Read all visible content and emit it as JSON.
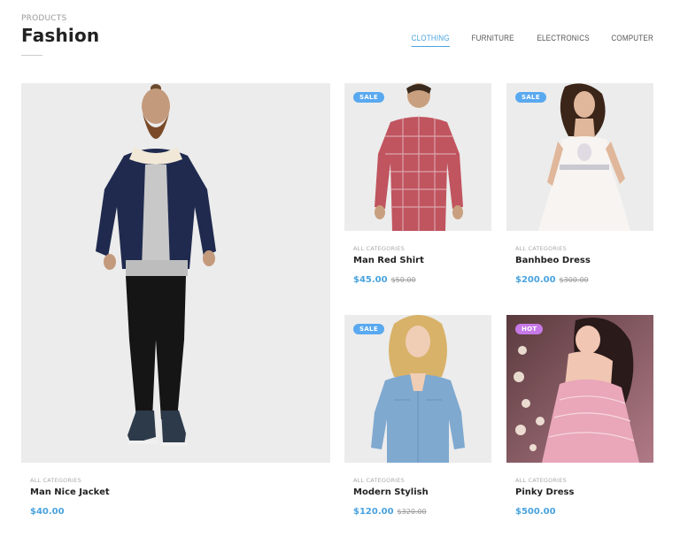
{
  "section": {
    "eyebrow": "PRODUCTS",
    "title": "Fashion"
  },
  "tabs": [
    {
      "label": "CLOTHING",
      "active": true
    },
    {
      "label": "FURNITURE",
      "active": false
    },
    {
      "label": "ELECTRONICS",
      "active": false
    },
    {
      "label": "COMPUTER",
      "active": false
    }
  ],
  "colors": {
    "accent": "#4aa3df",
    "sale_badge": "#59a9f0",
    "hot_badge": "#c779e8"
  },
  "products": [
    {
      "category": "ALL CATEGORIES",
      "name": "Man Nice Jacket",
      "price": "$40.00",
      "old_price": "",
      "badge": ""
    },
    {
      "category": "ALL CATEGORIES",
      "name": "Man Red Shirt",
      "price": "$45.00",
      "old_price": "$50.00",
      "badge": "SALE"
    },
    {
      "category": "ALL CATEGORIES",
      "name": "Banhbeo Dress",
      "price": "$200.00",
      "old_price": "$300.00",
      "badge": "SALE"
    },
    {
      "category": "ALL CATEGORIES",
      "name": "Modern Stylish",
      "price": "$120.00",
      "old_price": "$320.00",
      "badge": "SALE"
    },
    {
      "category": "ALL CATEGORIES",
      "name": "Pinky Dress",
      "price": "$500.00",
      "old_price": "",
      "badge": "HOT"
    }
  ]
}
